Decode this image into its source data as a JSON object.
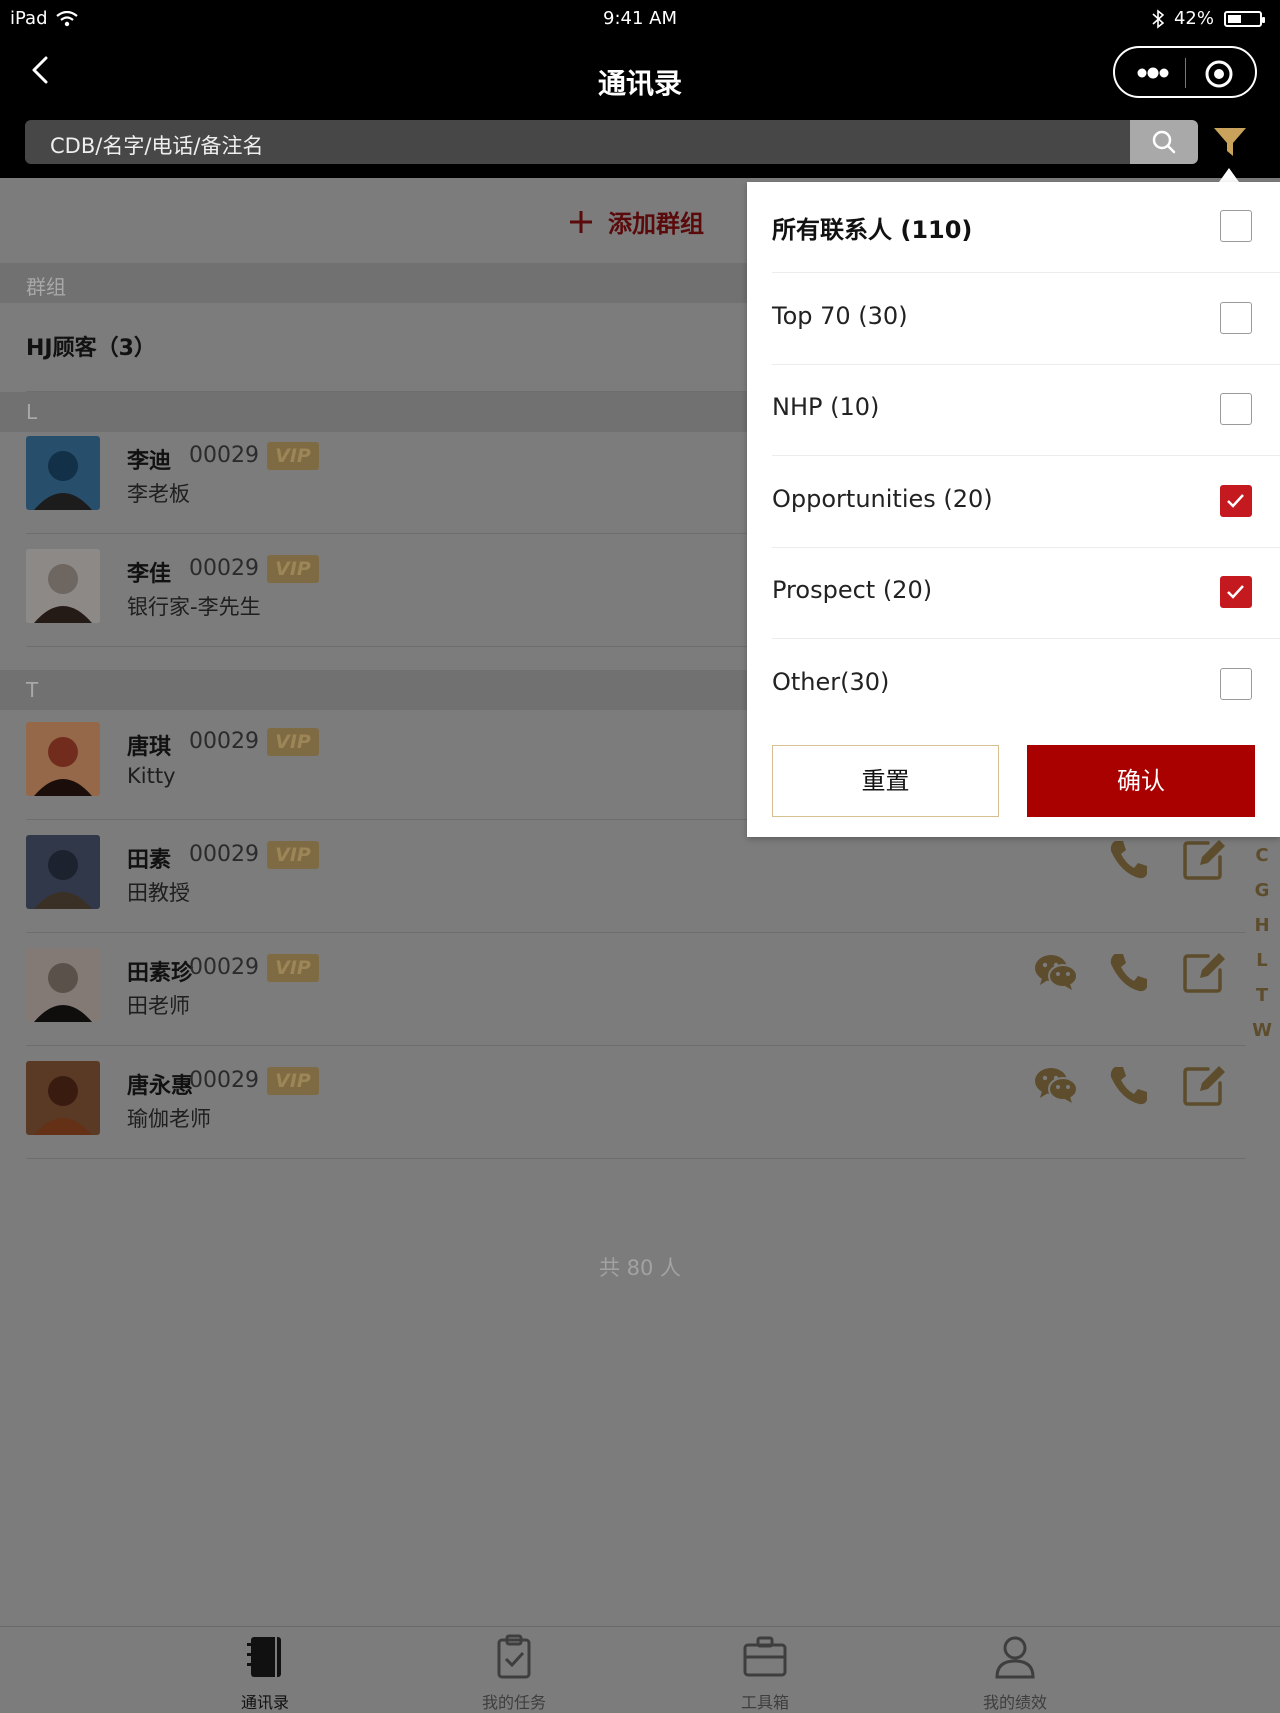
{
  "status_bar": {
    "device": "iPad",
    "time": "9:41 AM",
    "battery": "42%",
    "battery_level": 0.42
  },
  "nav": {
    "title": "通讯录"
  },
  "search": {
    "placeholder": "CDB/名字/电话/备注名"
  },
  "add_group": {
    "label": "添加群组"
  },
  "sections": {
    "groups": "群组",
    "l": "L",
    "t": "T"
  },
  "group": {
    "name": "HJ顾客（3）"
  },
  "contacts": [
    {
      "name": "李迪",
      "code": "00029",
      "badge": "VIP",
      "remark": "李老板",
      "actions": []
    },
    {
      "name": "李佳",
      "code": "00029",
      "badge": "VIP",
      "remark": "银行家-李先生",
      "actions": []
    },
    {
      "name": "唐琪",
      "code": "00029",
      "badge": "VIP",
      "remark": "Kitty",
      "actions": []
    },
    {
      "name": "田素",
      "code": "00029",
      "badge": "VIP",
      "remark": "田教授",
      "actions": [
        "phone-icon",
        "edit-icon"
      ]
    },
    {
      "name": "田素珍",
      "code": "00029",
      "badge": "VIP",
      "remark": "田老师",
      "actions": [
        "wechat-icon",
        "phone-icon",
        "edit-icon"
      ]
    },
    {
      "name": "唐永惠",
      "code": "00029",
      "badge": "VIP",
      "remark": "瑜伽老师",
      "actions": [
        "wechat-icon",
        "phone-icon",
        "edit-icon"
      ]
    }
  ],
  "total": "共 80 人",
  "index_letters": [
    "C",
    "G",
    "H",
    "L",
    "T",
    "W"
  ],
  "filter": {
    "options": [
      {
        "label": "所有联系人 (110)",
        "checked": false
      },
      {
        "label": "Top 70 (30)",
        "checked": false
      },
      {
        "label": "NHP (10)",
        "checked": false
      },
      {
        "label": "Opportunities (20)",
        "checked": true
      },
      {
        "label": "Prospect (20)",
        "checked": true
      },
      {
        "label": "Other(30)",
        "checked": false
      }
    ],
    "reset_label": "重置",
    "confirm_label": "确认"
  },
  "tabs": [
    {
      "label": "通讯录",
      "icon": "contacts-book-icon",
      "active": true
    },
    {
      "label": "我的任务",
      "icon": "task-clipboard-icon",
      "active": false
    },
    {
      "label": "工具箱",
      "icon": "toolbox-icon",
      "active": false
    },
    {
      "label": "我的绩效",
      "icon": "user-profile-icon",
      "active": false
    }
  ],
  "colors": {
    "accent_gold": "#5d4d2d",
    "brand_red": "#a90000",
    "checkbox_red": "#c41a1f"
  }
}
